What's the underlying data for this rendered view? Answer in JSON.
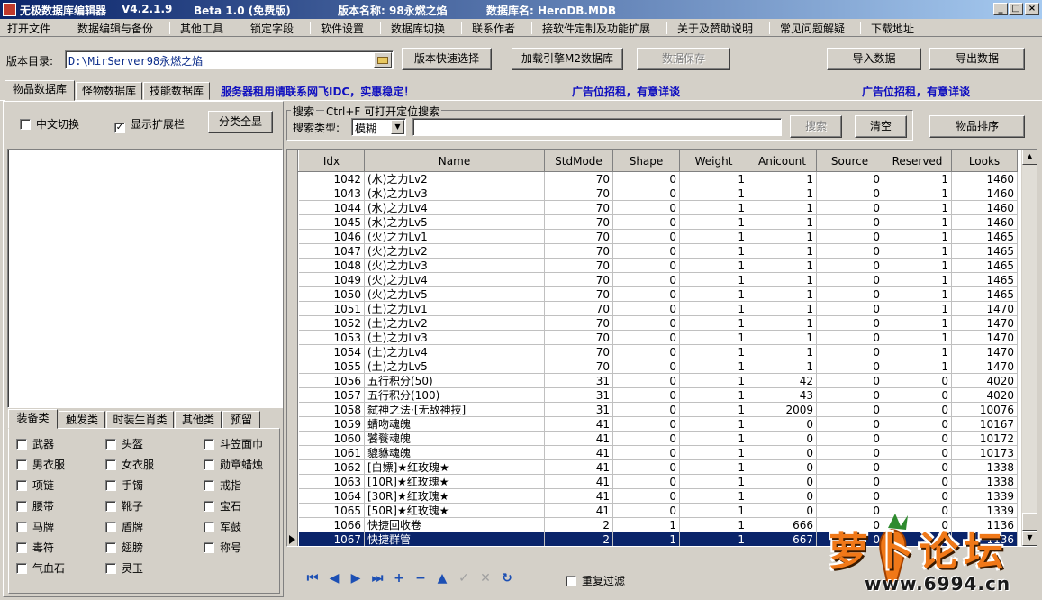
{
  "titlebar": {
    "app": "无极数据库编辑器",
    "version": "V4.2.1.9",
    "edition": "Beta 1.0 (免费版)",
    "version_name": "版本名称: 98永燃之焰",
    "db_name": "数据库名: HeroDB.MDB",
    "buttons": [
      "_",
      "□",
      "×"
    ]
  },
  "menu": [
    "打开文件",
    "数据编辑与备份",
    "其他工具",
    "锁定字段",
    "软件设置",
    "数据库切换",
    "联系作者",
    "接软件定制及功能扩展",
    "关于及赞助说明",
    "常见问题解疑",
    "下载地址"
  ],
  "toolbar": {
    "dir_label": "版本目录:",
    "dir_value": "D:\\MirServer98永燃之焰",
    "quick_select": "版本快速选择",
    "load_engine": "加载引擎M2数据库",
    "save": "数据保存",
    "import": "导入数据",
    "export": "导出数据"
  },
  "tabs": [
    "物品数据库",
    "怪物数据库",
    "技能数据库"
  ],
  "ads": [
    "服务器租用请联系网飞IDC，实惠稳定！",
    "广告位招租，有意详谈",
    "广告位招租，有意详谈"
  ],
  "left": {
    "cn_switch": "中文切换",
    "show_ext": "显示扩展栏",
    "show_all": "分类全显",
    "cat_tabs": [
      "装备类",
      "触发类",
      "时装生肖类",
      "其他类",
      "预留"
    ],
    "categories": [
      "武器",
      "头盔",
      "斗笠面巾",
      "男衣服",
      "女衣服",
      "勋章蜡烛",
      "项链",
      "手镯",
      "戒指",
      "腰带",
      "靴子",
      "宝石",
      "马牌",
      "盾牌",
      "军鼓",
      "毒符",
      "翅膀",
      "称号",
      "气血石",
      "灵玉"
    ]
  },
  "search": {
    "title": "搜索",
    "hint": "Ctrl+F 可打开定位搜索",
    "type_label": "搜索类型:",
    "type_value": "模糊",
    "query": "",
    "search_btn": "搜索",
    "clear_btn": "清空",
    "sort_btn": "物品排序"
  },
  "grid": {
    "columns": [
      "Idx",
      "Name",
      "StdMode",
      "Shape",
      "Weight",
      "Anicount",
      "Source",
      "Reserved",
      "Looks"
    ],
    "selected_index": 25,
    "rows": [
      [
        "1042",
        "(水)之力Lv2",
        "70",
        "0",
        "1",
        "1",
        "0",
        "1",
        "1460"
      ],
      [
        "1043",
        "(水)之力Lv3",
        "70",
        "0",
        "1",
        "1",
        "0",
        "1",
        "1460"
      ],
      [
        "1044",
        "(水)之力Lv4",
        "70",
        "0",
        "1",
        "1",
        "0",
        "1",
        "1460"
      ],
      [
        "1045",
        "(水)之力Lv5",
        "70",
        "0",
        "1",
        "1",
        "0",
        "1",
        "1460"
      ],
      [
        "1046",
        "(火)之力Lv1",
        "70",
        "0",
        "1",
        "1",
        "0",
        "1",
        "1465"
      ],
      [
        "1047",
        "(火)之力Lv2",
        "70",
        "0",
        "1",
        "1",
        "0",
        "1",
        "1465"
      ],
      [
        "1048",
        "(火)之力Lv3",
        "70",
        "0",
        "1",
        "1",
        "0",
        "1",
        "1465"
      ],
      [
        "1049",
        "(火)之力Lv4",
        "70",
        "0",
        "1",
        "1",
        "0",
        "1",
        "1465"
      ],
      [
        "1050",
        "(火)之力Lv5",
        "70",
        "0",
        "1",
        "1",
        "0",
        "1",
        "1465"
      ],
      [
        "1051",
        "(土)之力Lv1",
        "70",
        "0",
        "1",
        "1",
        "0",
        "1",
        "1470"
      ],
      [
        "1052",
        "(土)之力Lv2",
        "70",
        "0",
        "1",
        "1",
        "0",
        "1",
        "1470"
      ],
      [
        "1053",
        "(土)之力Lv3",
        "70",
        "0",
        "1",
        "1",
        "0",
        "1",
        "1470"
      ],
      [
        "1054",
        "(土)之力Lv4",
        "70",
        "0",
        "1",
        "1",
        "0",
        "1",
        "1470"
      ],
      [
        "1055",
        "(土)之力Lv5",
        "70",
        "0",
        "1",
        "1",
        "0",
        "1",
        "1470"
      ],
      [
        "1056",
        "五行积分(50)",
        "31",
        "0",
        "1",
        "42",
        "0",
        "0",
        "4020"
      ],
      [
        "1057",
        "五行积分(100)",
        "31",
        "0",
        "1",
        "43",
        "0",
        "0",
        "4020"
      ],
      [
        "1058",
        "弑神之法·[无敌神技]",
        "31",
        "0",
        "1",
        "2009",
        "0",
        "0",
        "10076"
      ],
      [
        "1059",
        "蜻吻魂魄",
        "41",
        "0",
        "1",
        "0",
        "0",
        "0",
        "10167"
      ],
      [
        "1060",
        "饕餮魂魄",
        "41",
        "0",
        "1",
        "0",
        "0",
        "0",
        "10172"
      ],
      [
        "1061",
        "貔貅魂魄",
        "41",
        "0",
        "1",
        "0",
        "0",
        "0",
        "10173"
      ],
      [
        "1062",
        "[白嫖]★红玫瑰★",
        "41",
        "0",
        "1",
        "0",
        "0",
        "0",
        "1338"
      ],
      [
        "1063",
        "[10R]★红玫瑰★",
        "41",
        "0",
        "1",
        "0",
        "0",
        "0",
        "1338"
      ],
      [
        "1064",
        "[30R]★红玫瑰★",
        "41",
        "0",
        "1",
        "0",
        "0",
        "0",
        "1339"
      ],
      [
        "1065",
        "[50R]★红玫瑰★",
        "41",
        "0",
        "1",
        "0",
        "0",
        "0",
        "1339"
      ],
      [
        "1066",
        "快捷回收卷",
        "2",
        "1",
        "1",
        "666",
        "0",
        "0",
        "1136"
      ],
      [
        "1067",
        "快捷群管",
        "2",
        "1",
        "1",
        "667",
        "0",
        "0",
        "1136"
      ]
    ]
  },
  "nav": {
    "buttons": [
      "first-icon",
      "prior-icon",
      "next-icon",
      "last-icon",
      "insert-icon",
      "delete-icon",
      "edit-icon",
      "post-icon",
      "cancel-icon",
      "refresh-icon"
    ],
    "dup_filter": "重复过滤"
  },
  "watermark": {
    "brand": "萝卜论坛",
    "site": "www.6994.cn"
  }
}
